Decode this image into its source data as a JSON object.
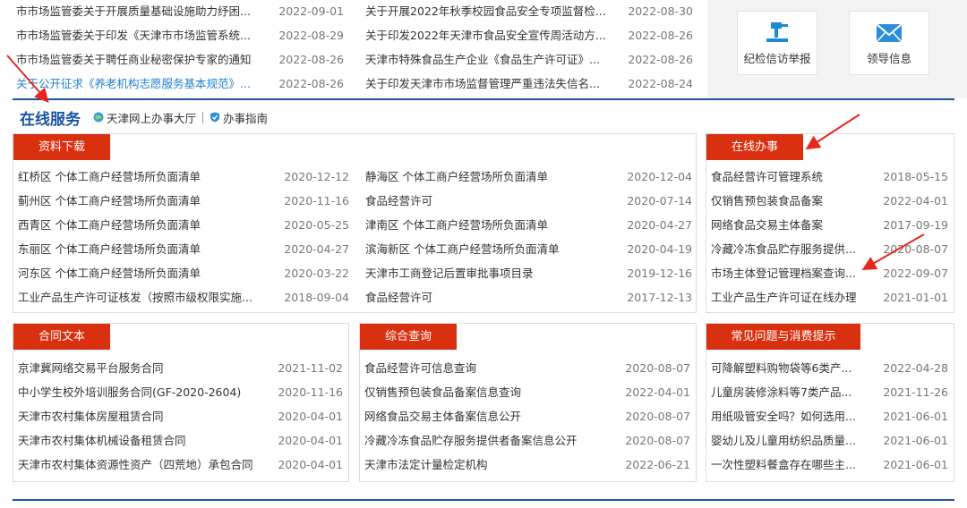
{
  "top_news": {
    "left": [
      {
        "title": "市市场监管委关于开展质量基础设施助力纾困...",
        "date": "2022-09-01"
      },
      {
        "title": "市市场监管委关于印发《天津市市场监管系统...",
        "date": "2022-08-29"
      },
      {
        "title": "市市场监管委关于聘任商业秘密保护专家的通知",
        "date": "2022-08-26"
      },
      {
        "title": "关于公开征求《养老机构志愿服务基本规范》...",
        "date": "2022-08-26"
      }
    ],
    "mid": [
      {
        "title": "关于开展2022年秋季校园食品安全专项监督检...",
        "date": "2022-08-30"
      },
      {
        "title": "关于印发2022年天津市食品安全宣传周活动方...",
        "date": "2022-08-26"
      },
      {
        "title": "天津市特殊食品生产企业《食品生产许可证》...",
        "date": "2022-08-26"
      },
      {
        "title": "关于印发天津市市场监督管理严重违法失信名...",
        "date": "2022-08-24"
      }
    ]
  },
  "side_buttons": {
    "jijian": {
      "label": "纪检信访举报",
      "icon": "gavel-icon"
    },
    "lingdao": {
      "label": "领导信息",
      "icon": "envelope-icon"
    }
  },
  "section": {
    "title": "在线服务",
    "link1": "天津网上办事大厅",
    "link2": "办事指南"
  },
  "ziliao": {
    "tag": "资料下载",
    "col1": [
      {
        "title": "红桥区 个体工商户经营场所负面清单",
        "date": "2020-12-12"
      },
      {
        "title": "蓟州区 个体工商户经营场所负面清单",
        "date": "2020-11-16"
      },
      {
        "title": "西青区 个体工商户经营场所负面清单",
        "date": "2020-05-25"
      },
      {
        "title": "东丽区 个体工商户经营场所负面清单",
        "date": "2020-04-27"
      },
      {
        "title": "河东区 个体工商户经营场所负面清单",
        "date": "2020-03-22"
      },
      {
        "title": "工业产品生产许可证核发（按照市级权限实施...",
        "date": "2018-09-04"
      }
    ],
    "col2": [
      {
        "title": "静海区 个体工商户经营场所负面清单",
        "date": "2020-12-04"
      },
      {
        "title": "食品经营许可",
        "date": "2020-07-14"
      },
      {
        "title": "津南区 个体工商户经营场所负面清单",
        "date": "2020-04-27"
      },
      {
        "title": "滨海新区 个体工商户经营场所负面清单",
        "date": "2020-04-19"
      },
      {
        "title": "天津市工商登记后置审批事项目录",
        "date": "2019-12-16"
      },
      {
        "title": "食品经营许可",
        "date": "2017-12-13"
      }
    ]
  },
  "online": {
    "tag": "在线办事",
    "items": [
      {
        "title": "食品经营许可管理系统",
        "date": "2018-05-15"
      },
      {
        "title": "仅销售预包装食品备案",
        "date": "2022-04-01"
      },
      {
        "title": "网络食品交易主体备案",
        "date": "2017-09-19"
      },
      {
        "title": "冷藏冷冻食品贮存服务提供...",
        "date": "2020-08-07"
      },
      {
        "title": "市场主体登记管理档案查询...",
        "date": "2022-09-07"
      },
      {
        "title": "工业产品生产许可证在线办理",
        "date": "2021-01-01"
      }
    ]
  },
  "hetong": {
    "tag": "合同文本",
    "items": [
      {
        "title": "京津冀网络交易平台服务合同",
        "date": "2021-11-02"
      },
      {
        "title": "中小学生校外培训服务合同(GF-2020-2604)",
        "date": "2020-11-16"
      },
      {
        "title": "天津市农村集体房屋租赁合同",
        "date": "2020-04-01"
      },
      {
        "title": "天津市农村集体机械设备租赁合同",
        "date": "2020-04-01"
      },
      {
        "title": "天津市农村集体资源性资产（四荒地）承包合同",
        "date": "2020-04-01"
      }
    ]
  },
  "query": {
    "tag": "综合查询",
    "items": [
      {
        "title": "食品经营许可信息查询",
        "date": "2020-08-07"
      },
      {
        "title": "仅销售预包装食品备案信息查询",
        "date": "2022-04-01"
      },
      {
        "title": "网络食品交易主体备案信息公开",
        "date": "2020-08-07"
      },
      {
        "title": "冷藏冷冻食品贮存服务提供者备案信息公开",
        "date": "2020-08-07"
      },
      {
        "title": "天津市法定计量检定机构",
        "date": "2022-06-21"
      }
    ]
  },
  "faq": {
    "tag": "常见问题与消费提示",
    "items": [
      {
        "title": "可降解塑料购物袋等6类产...",
        "date": "2022-04-28"
      },
      {
        "title": "儿童房装修涂料等7类产品...",
        "date": "2021-11-26"
      },
      {
        "title": "用纸吸管安全吗？如何选用...",
        "date": "2021-06-01"
      },
      {
        "title": "婴幼儿及儿童用纺织品质量...",
        "date": "2021-06-01"
      },
      {
        "title": "一次性塑料餐盒存在哪些主...",
        "date": "2021-06-01"
      }
    ]
  },
  "colors": {
    "brand_blue": "#1a56a6",
    "tag_red": "#d9300f",
    "link_blue": "#1f7fd1",
    "arrow_red": "#e8261c"
  }
}
